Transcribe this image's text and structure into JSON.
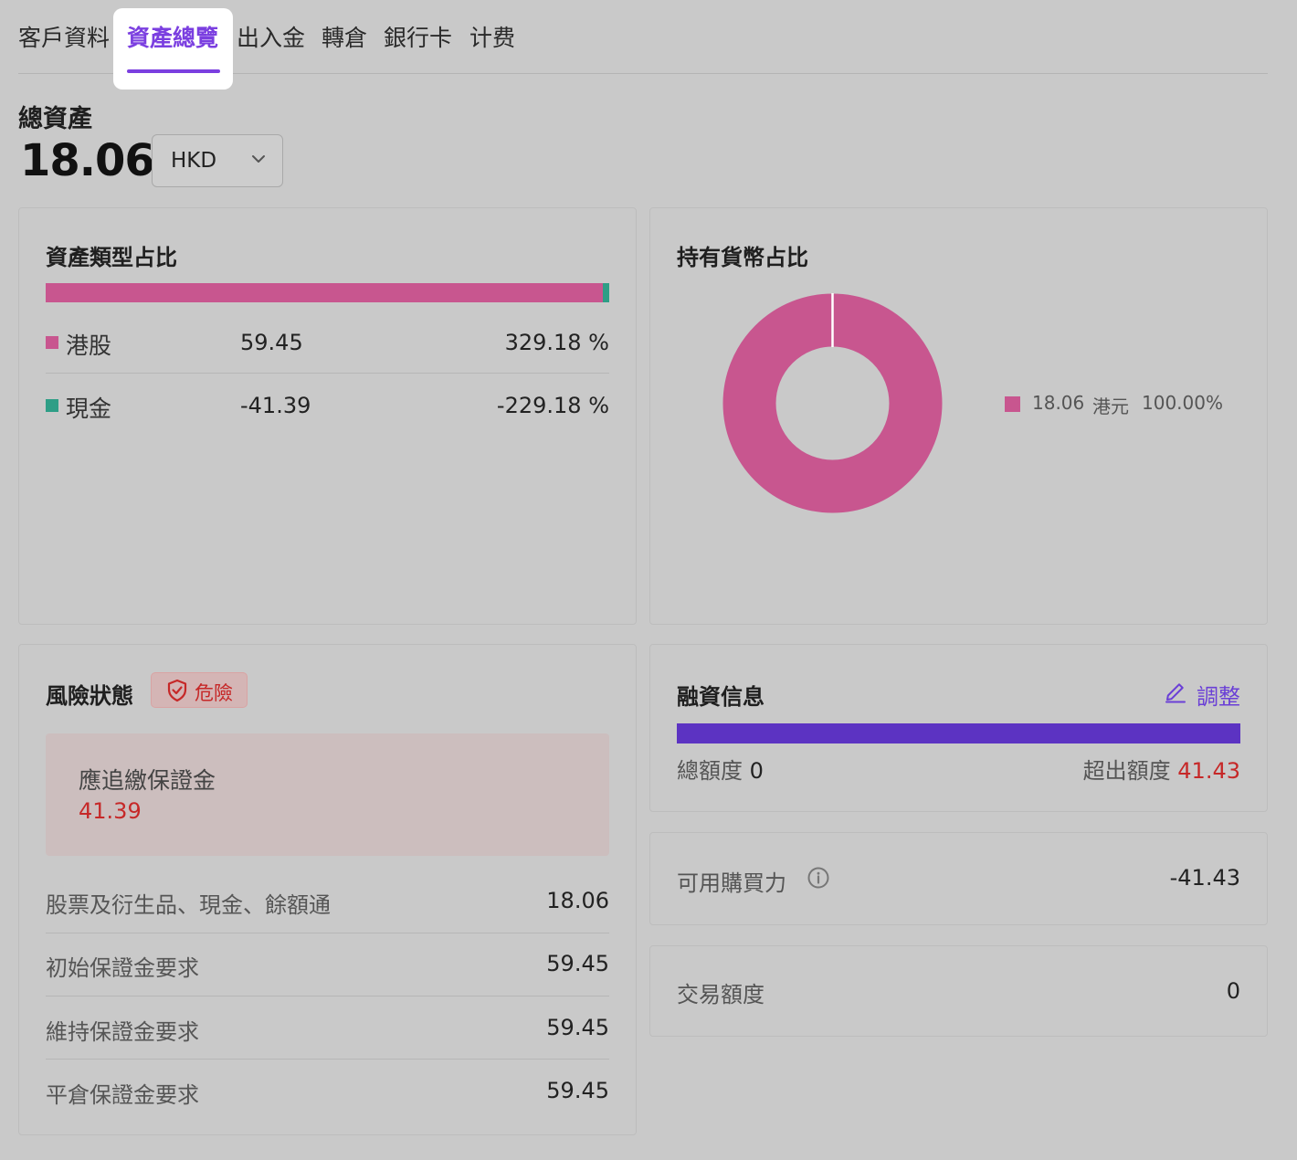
{
  "tabs": {
    "items": [
      {
        "label": "客戶資料"
      },
      {
        "label": "資產總覽",
        "active": true
      },
      {
        "label": "出入金"
      },
      {
        "label": "轉倉"
      },
      {
        "label": "銀行卡"
      },
      {
        "label": "计费"
      }
    ]
  },
  "total_assets": {
    "label": "總資產",
    "value": "18.06",
    "currency": "HKD",
    "currency_icon": "chevron-down-icon"
  },
  "asset_type": {
    "title": "資產類型占比",
    "rows": [
      {
        "name": "港股",
        "amount": "59.45",
        "percent": "329.18 %",
        "color": "#c8568f"
      },
      {
        "name": "現金",
        "amount": "-41.39",
        "percent": "-229.18 %",
        "color": "#2e9e86"
      }
    ]
  },
  "currency_holdings": {
    "title": "持有貨幣占比",
    "legend": {
      "amount": "18.06",
      "name": "港元",
      "percent": "100.00%"
    },
    "color": "#c8568f",
    "share": 1.0
  },
  "risk": {
    "title": "風險狀態",
    "badge": "危險",
    "badge_icon": "shield-icon",
    "margin_call": {
      "label": "應追繳保證金",
      "value": "41.39"
    },
    "rows": [
      {
        "label": "股票及衍生品、現金、餘額通",
        "value": "18.06"
      },
      {
        "label": "初始保證金要求",
        "value": "59.45"
      },
      {
        "label": "維持保證金要求",
        "value": "59.45"
      },
      {
        "label": "平倉保證金要求",
        "value": "59.45"
      }
    ]
  },
  "financing": {
    "title": "融資信息",
    "adjust_label": "調整",
    "adjust_icon": "pencil-icon",
    "total_label": "總額度",
    "total_value": "0",
    "exceed_label": "超出額度",
    "exceed_value": "41.43",
    "bar_color": "#5c33c2"
  },
  "buying_power": {
    "label": "可用購買力",
    "value": "-41.43",
    "icon": "info-icon"
  },
  "trade_limit": {
    "label": "交易額度",
    "value": "0"
  },
  "colors": {
    "accent": "#7b3fe0",
    "danger": "#c62828"
  }
}
